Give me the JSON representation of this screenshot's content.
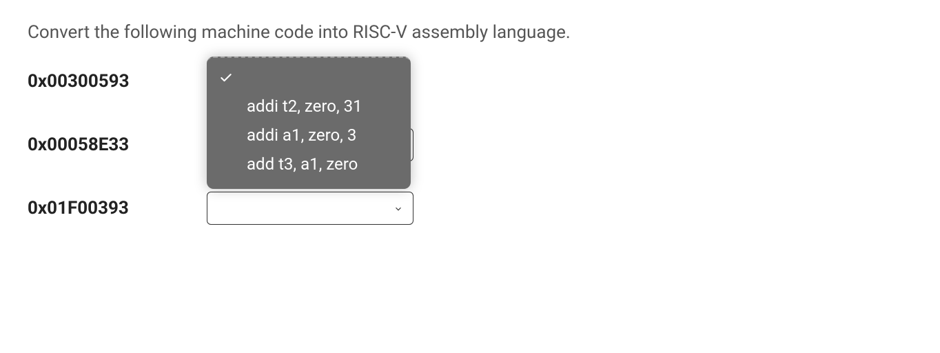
{
  "question": "Convert the following machine code  into RISC-V assembly language.",
  "rows": [
    {
      "code": "0x00300593"
    },
    {
      "code": "0x00058E33"
    },
    {
      "code": "0x01F00393"
    }
  ],
  "dropdown": {
    "options": [
      "addi t2, zero, 31",
      "addi a1, zero, 3",
      "add t3, a1, zero"
    ]
  }
}
